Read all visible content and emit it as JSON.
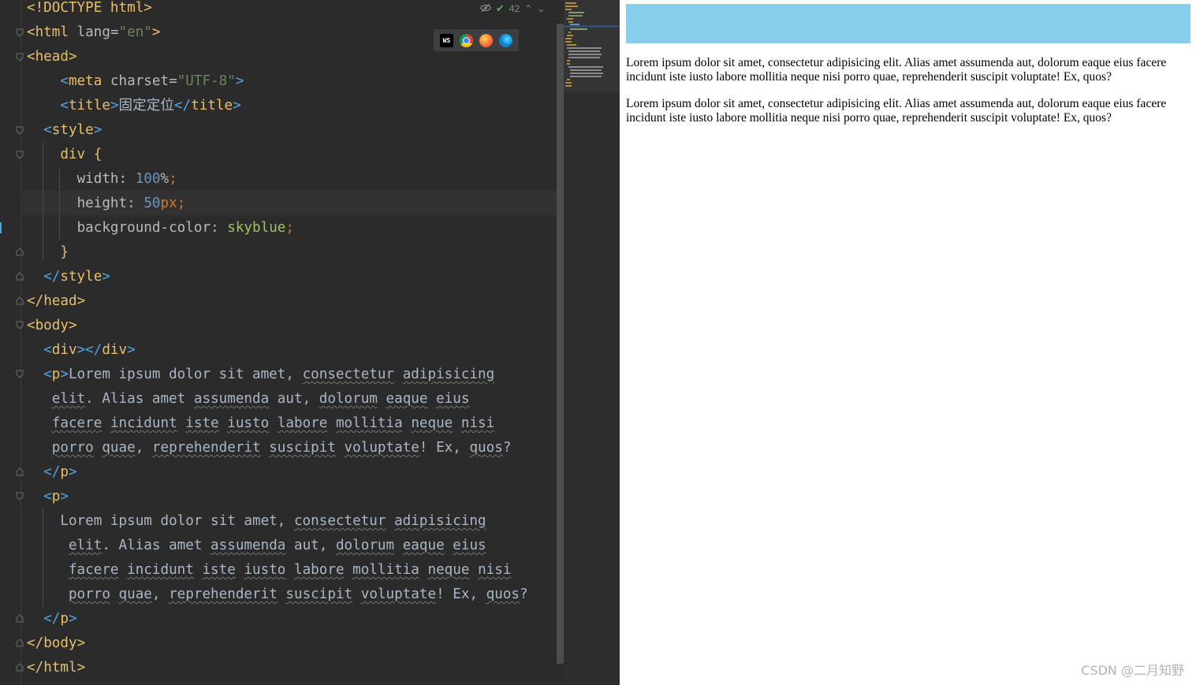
{
  "editor": {
    "inspection": {
      "count": "42"
    },
    "browser_icons": [
      "webstorm-icon",
      "chrome-icon",
      "firefox-icon",
      "edge-icon"
    ],
    "lines": {
      "l1": "<!DOCTYPE html>",
      "l2_tag": "html",
      "l2_attr": "lang",
      "l2_val": "\"en\"",
      "l3": "head",
      "l4_tag": "meta",
      "l4_attr": "charset",
      "l4_val": "\"UTF-8\"",
      "l5_tag": "title",
      "l5_text": "固定定位",
      "l6": "style",
      "l7": "div",
      "l8_prop": "width",
      "l8_num": "100",
      "l8_unit": "%",
      "l9_prop": "height",
      "l9_num": "50",
      "l9_unit": "px",
      "l10_prop": "background-color",
      "l10_val": "skyblue",
      "l14": "body",
      "l15": "div",
      "p_tag": "p"
    },
    "p1": [
      "Lorem ipsum dolor sit amet,",
      "consectetur",
      "adipisicing",
      "elit",
      ". Alias amet",
      "assumenda",
      "aut,",
      "dolorum",
      "eaque",
      "eius",
      "facere",
      "incidunt",
      "iste",
      "iusto",
      "labore",
      "mollitia",
      "neque",
      "nisi",
      "porro",
      "quae",
      "reprehenderit",
      "suscipit",
      "voluptate",
      "! Ex,",
      "quos",
      "?"
    ]
  },
  "preview": {
    "paragraph_1": "Lorem ipsum dolor sit amet, consectetur adipisicing elit. Alias amet assumenda aut, dolorum eaque eius facere incidunt iste iusto labore mollitia neque nisi porro quae, reprehenderit suscipit voluptate! Ex, quos?",
    "paragraph_2": "Lorem ipsum dolor sit amet, consectetur adipisicing elit. Alias amet assumenda aut, dolorum eaque eius facere incidunt iste iusto labore mollitia neque nisi porro quae, reprehenderit suscipit voluptate! Ex, quos?",
    "div_color": "#87ceeb",
    "watermark": "CSDN @二月知野"
  }
}
